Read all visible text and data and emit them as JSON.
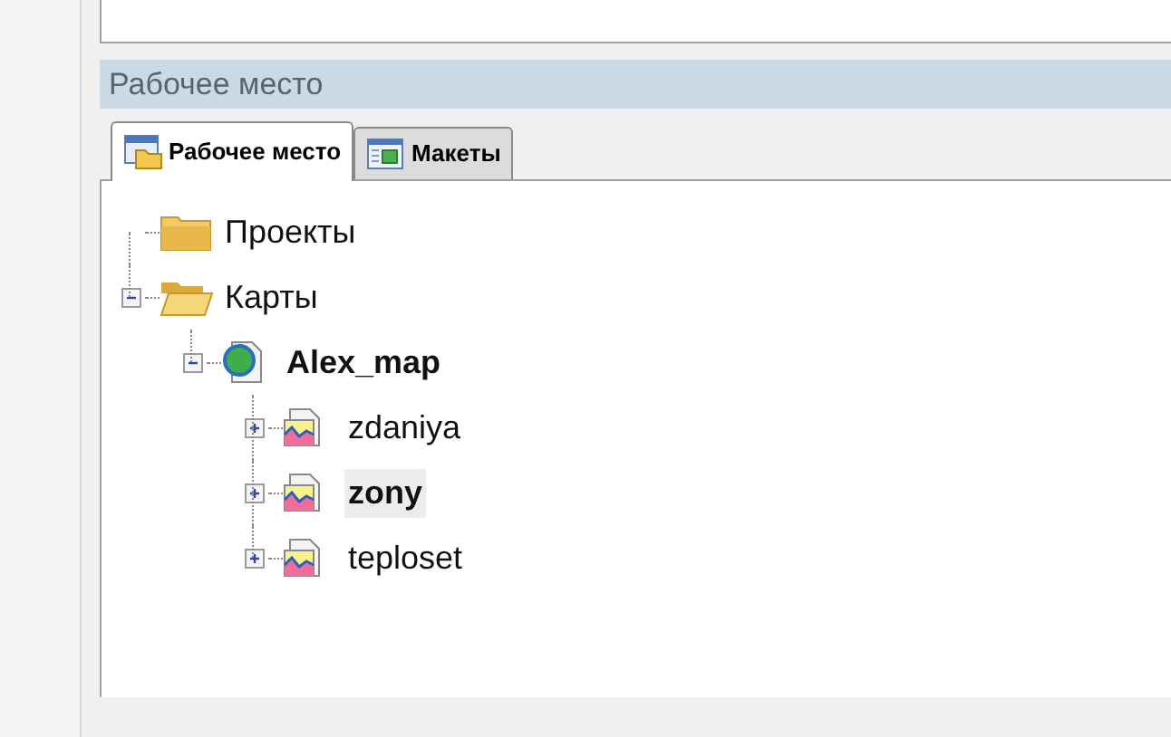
{
  "panel": {
    "title": "Рабочее место"
  },
  "tabs": [
    {
      "label": "Рабочее место",
      "kind": "workspace",
      "selected": true
    },
    {
      "label": "Макеты",
      "kind": "layouts",
      "selected": false
    }
  ],
  "tree": [
    {
      "label": "Проекты",
      "kind": "folder",
      "expandable": false,
      "expanded": false,
      "bold": false,
      "selected": false
    },
    {
      "label": "Карты",
      "kind": "folder",
      "expandable": true,
      "expanded": true,
      "bold": false,
      "selected": false,
      "children": [
        {
          "label": "Alex_map",
          "kind": "map",
          "expandable": true,
          "expanded": true,
          "bold": true,
          "selected": false,
          "children": [
            {
              "label": "zdaniya",
              "kind": "layer",
              "expandable": true,
              "expanded": false,
              "bold": false,
              "selected": false
            },
            {
              "label": "zony",
              "kind": "layer",
              "expandable": true,
              "expanded": false,
              "bold": true,
              "selected": true
            },
            {
              "label": "teploset",
              "kind": "layer",
              "expandable": true,
              "expanded": false,
              "bold": false,
              "selected": false
            }
          ]
        }
      ]
    }
  ]
}
